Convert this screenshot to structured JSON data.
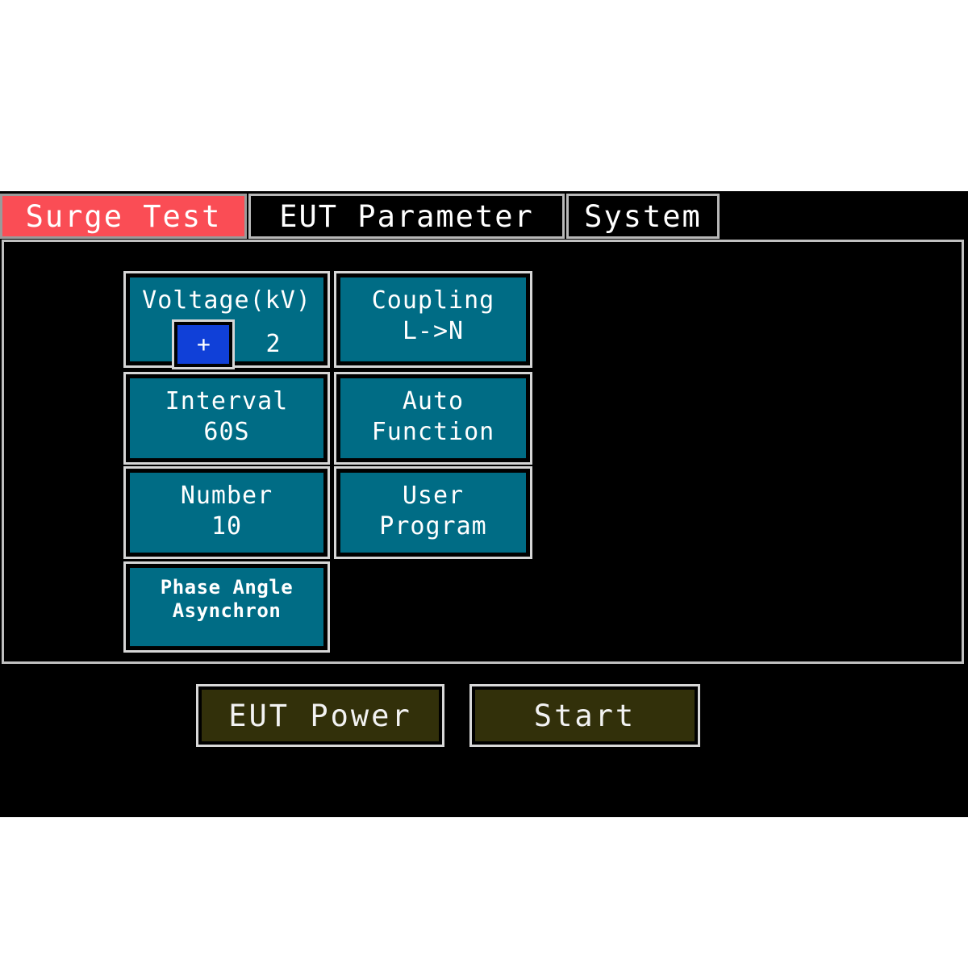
{
  "screen": {
    "background_color": "#000000",
    "page_background_color": "#ffffff"
  },
  "tabs": [
    {
      "label": "Surge Test",
      "name": "tab-surge-test",
      "active": true,
      "active_color": "#fa4d55"
    },
    {
      "label": "EUT Parameter",
      "name": "tab-eut-parameter",
      "active": false
    },
    {
      "label": "System",
      "name": "tab-system",
      "active": false
    }
  ],
  "parameters": {
    "voltage": {
      "title": "Voltage(kV)",
      "value": "2",
      "polarity": "+",
      "polarity_color": "#1040d8"
    },
    "coupling": {
      "title": "Coupling",
      "value": "L->N"
    },
    "interval": {
      "title": "Interval",
      "value": "60S"
    },
    "auto": {
      "title": "Auto",
      "value": "Function"
    },
    "number": {
      "title": "Number",
      "value": "10"
    },
    "user": {
      "title": "User",
      "value": "Program"
    },
    "phase_angle": {
      "title": "Phase Angle",
      "value": "Asynchron"
    }
  },
  "actions": {
    "eut_power": "EUT Power",
    "start": "Start",
    "button_color": "#32300a"
  },
  "theme": {
    "button_fill": "#006c85",
    "button_border": "#d6d6d6",
    "text_color": "#ffffff"
  }
}
